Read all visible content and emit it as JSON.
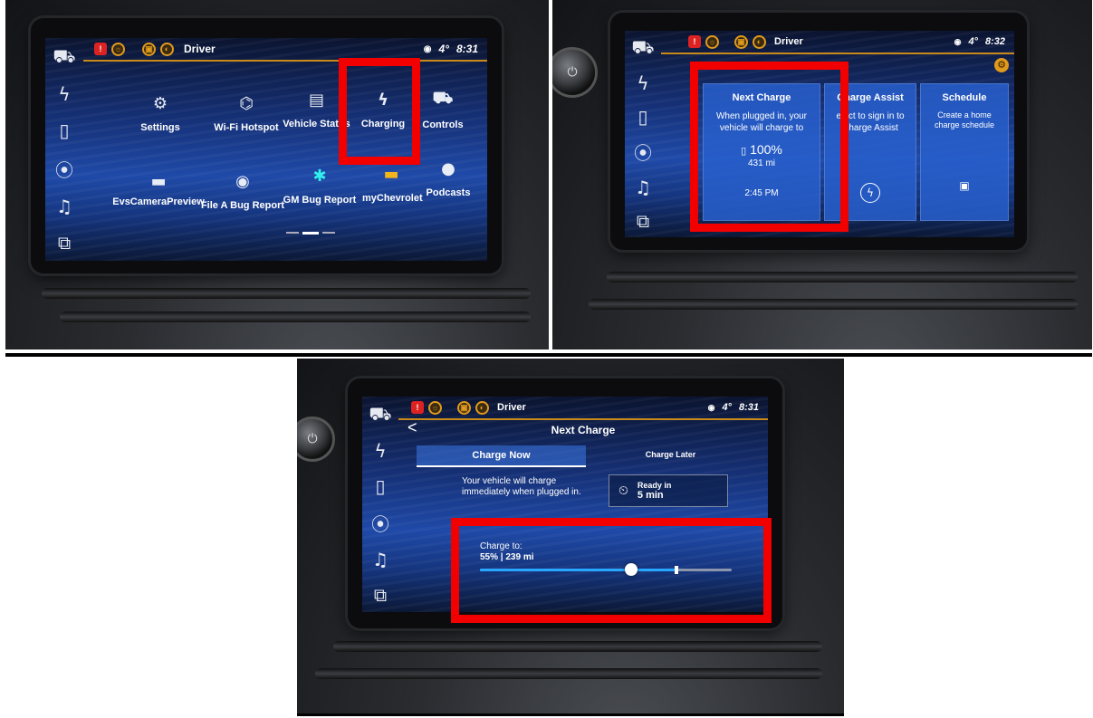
{
  "status": {
    "user": "Driver",
    "temp": "4°",
    "time_panel1": "8:31",
    "time_panel2": "8:32",
    "time_panel3": "8:31"
  },
  "rail_icons": [
    "car-icon",
    "lightning-icon",
    "phone-icon",
    "location-pin-icon",
    "music-note-icon",
    "layers-icon"
  ],
  "panel1": {
    "apps_row1": [
      {
        "label": "Settings",
        "icon": "gear-icon",
        "glyph": "⚙"
      },
      {
        "label": "Wi-Fi Hotspot",
        "icon": "hotspot-icon",
        "glyph": "⌬"
      },
      {
        "label": "Vehicle Status",
        "icon": "status-icon",
        "glyph": "▤"
      },
      {
        "label": "Charging",
        "icon": "lightning-icon",
        "glyph": "ϟ"
      },
      {
        "label": "Controls",
        "icon": "car-icon",
        "glyph": "⛟"
      }
    ],
    "apps_row2": [
      {
        "label": "EvsCameraPreview",
        "icon": "camera-icon",
        "glyph": "▬"
      },
      {
        "label": "File A Bug Report",
        "icon": "bug-report-icon",
        "glyph": "◉"
      },
      {
        "label": "GM Bug Report",
        "icon": "bug-icon",
        "glyph": "✱"
      },
      {
        "label": "myChevrolet",
        "icon": "chevrolet-icon",
        "glyph": "▬"
      },
      {
        "label": "Podcasts",
        "icon": "podcast-icon",
        "glyph": "●"
      }
    ]
  },
  "panel2": {
    "next_charge": {
      "title": "Next Charge",
      "desc": "When plugged in, your vehicle will charge to",
      "percent": "100%",
      "range": "431 mi",
      "time": "2:45 PM"
    },
    "charge_assist": {
      "title": "Charge Assist",
      "desc": "elect to sign in to Charge Assist"
    },
    "schedule": {
      "title": "Schedule",
      "desc": "Create a home charge schedule"
    }
  },
  "panel3": {
    "back": "<",
    "title": "Next Charge",
    "tabs": [
      "Charge Now",
      "Charge Later"
    ],
    "message": "Your vehicle will charge immediately when plugged in.",
    "ready_label": "Ready in",
    "ready_value": "5 min",
    "charge_to_label": "Charge to:",
    "charge_to_value": "55% | 239 mi",
    "charge_level": 0.55,
    "limit_marker": 0.78
  },
  "colors": {
    "highlight": "#f20000",
    "accent": "#c98a1a",
    "slider": "#29a7ff"
  }
}
